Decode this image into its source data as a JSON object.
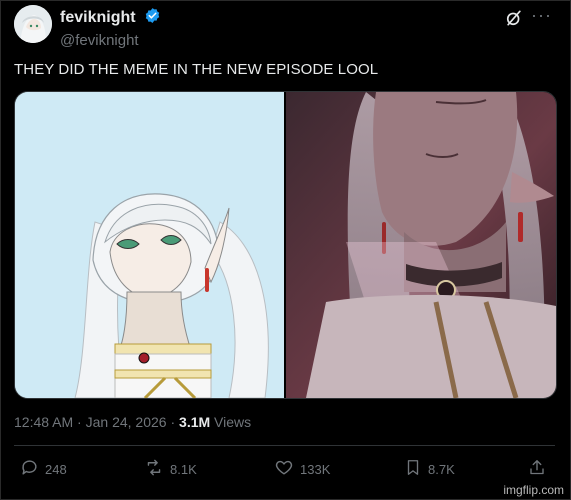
{
  "author": {
    "display_name": "feviknight",
    "handle": "@feviknight",
    "verified_icon": "verified-badge-icon",
    "avatar_icon": "avatar"
  },
  "header_actions": {
    "grok_icon": "grok-icon",
    "more_label": "···"
  },
  "tweet": {
    "text": "THEY DID THE MEME IN THE NEW EPISODE LOOL"
  },
  "media": {
    "left_panel": "drawing-panel",
    "right_panel": "screenshot-panel",
    "left_bg": "#cfeaf5",
    "right_bg": "#2e1c22"
  },
  "meta": {
    "time": "12:48 AM",
    "dot1": "·",
    "date": "Jan 24, 2026",
    "dot2": "·",
    "views_count": "3.1M",
    "views_label": "Views"
  },
  "actions": {
    "replies": "248",
    "reposts": "8.1K",
    "likes": "133K",
    "bookmarks": "8.7K"
  },
  "watermark": "imgflip.com",
  "colors": {
    "background": "#000000",
    "text": "#e7e9ea",
    "muted": "#71767b",
    "verified": "#1d9bf0"
  }
}
